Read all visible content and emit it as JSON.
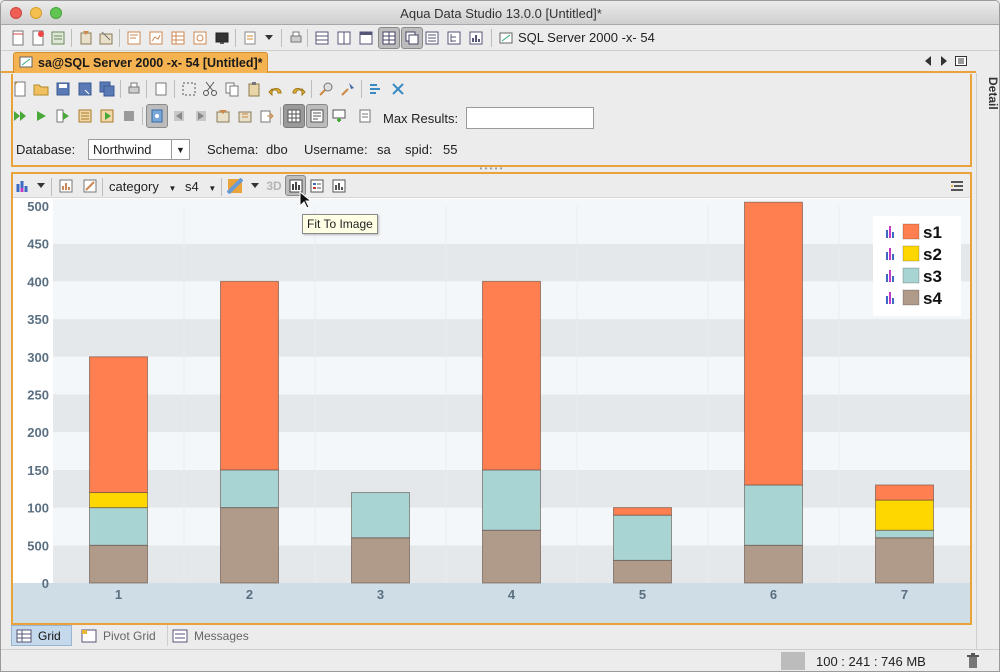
{
  "window": {
    "title": "Aqua Data Studio 13.0.0 [Untitled]*",
    "traffic_lights": [
      "#ee5f56",
      "#f5bf4f",
      "#61c554"
    ]
  },
  "main_toolbar": {
    "connection_label": "SQL Server 2000 -x- 54"
  },
  "doc_tab": {
    "label": "sa@SQL Server 2000 -x- 54 [Untitled]*"
  },
  "side_panel": {
    "label": "Detail"
  },
  "query_pane": {
    "max_results_label": "Max Results:",
    "max_results_value": "",
    "database_label": "Database:",
    "database_value": "Northwind",
    "schema_label": "Schema:",
    "schema_value": "dbo",
    "username_label": "Username:",
    "username_value": "sa",
    "spid_label": "spid:",
    "spid_value": "55"
  },
  "chart_toolbar": {
    "category_select": "category",
    "series_select": "s4",
    "label_3d": "3D",
    "tooltip": "Fit To Image"
  },
  "bottom_tabs": [
    {
      "label": "Grid",
      "active": true
    },
    {
      "label": "Pivot Grid",
      "active": false
    },
    {
      "label": "Messages",
      "active": false
    }
  ],
  "status": {
    "memory": "100 : 241 : 746 MB"
  },
  "colors": {
    "accent": "#e8a33a",
    "s1": "#ff7f50",
    "s2": "#ffd700",
    "s3": "#a8d4d4",
    "s4": "#b09a8a"
  },
  "chart_data": {
    "type": "bar",
    "stacked": true,
    "categories": [
      "1",
      "2",
      "3",
      "4",
      "5",
      "6",
      "7"
    ],
    "y_tick_labels": [
      "0",
      "500",
      "100",
      "150",
      "200",
      "250",
      "300",
      "350",
      "400",
      "450",
      "500"
    ],
    "ylim": [
      0,
      500
    ],
    "series": [
      {
        "name": "s4",
        "color": "#b09a8a",
        "values": [
          50,
          100,
          60,
          70,
          30,
          50,
          60
        ]
      },
      {
        "name": "s3",
        "color": "#a8d4d4",
        "values": [
          50,
          50,
          60,
          80,
          60,
          80,
          10
        ]
      },
      {
        "name": "s2",
        "color": "#ffd700",
        "values": [
          20,
          0,
          0,
          0,
          0,
          0,
          40
        ]
      },
      {
        "name": "s1",
        "color": "#ff7f50",
        "values": [
          180,
          250,
          0,
          250,
          10,
          375,
          20
        ]
      }
    ],
    "legend": {
      "placement": "top-right",
      "entries": [
        "s1",
        "s2",
        "s3",
        "s4"
      ]
    },
    "grid": "horizontal alternating bands"
  }
}
